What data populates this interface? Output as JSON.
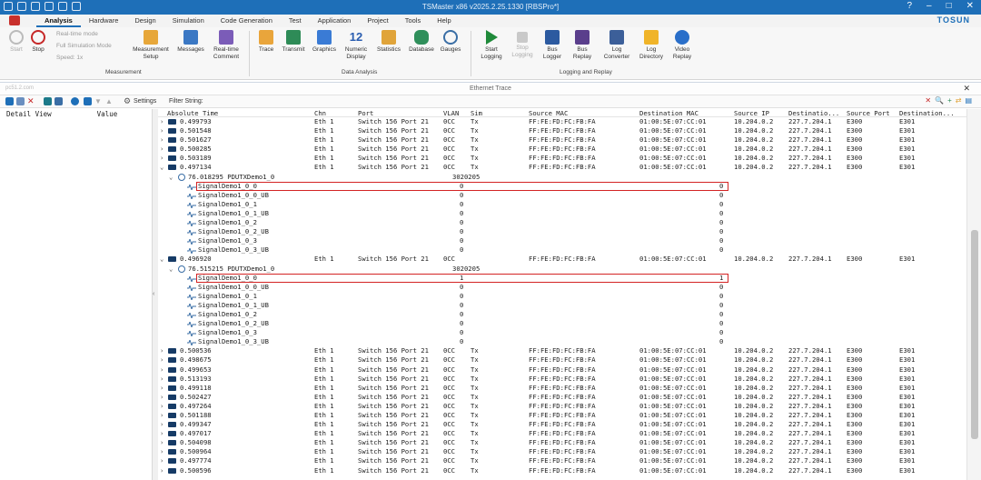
{
  "window": {
    "title": "TSMaster x86 v2025.2.25.1330 [RBSPro*]",
    "help": "?",
    "brand": "TOSUN"
  },
  "menu": [
    "Analysis",
    "Hardware",
    "Design",
    "Simulation",
    "Code Generation",
    "Test",
    "Application",
    "Project",
    "Tools",
    "Help"
  ],
  "ribbon": {
    "start": "Start",
    "stop": "Stop",
    "opt_realtime": "Real-time mode",
    "opt_fullsim": "Full Simulation Mode",
    "opt_speed": "Speed: 1x",
    "measurement_setup": "Measurement Setup",
    "messages": "Messages",
    "realtime_comment": "Real-time Comment",
    "group_measurement": "Measurement",
    "trace": "Trace",
    "transmit": "Transmit",
    "graphics": "Graphics",
    "numeric_display": "Numeric Display",
    "statistics": "Statistics",
    "database": "Database",
    "gauges": "Gauges",
    "group_data_analysis": "Data Analysis",
    "start_logging": "Start Logging",
    "stop_logging": "Stop Logging",
    "bus_logger": "Bus Logger",
    "bus_replay": "Bus Replay",
    "log_converter": "Log Converter",
    "log_directory": "Log Directory",
    "video_replay": "Video Replay",
    "group_logging": "Logging and Replay",
    "icon_colors": {
      "start": "#1f8a3a",
      "stop": "#c62828",
      "accent": "#1e6fb8"
    }
  },
  "panel": {
    "title": "Ethernet Trace",
    "path": "pc51.2.com",
    "settings": "Settings",
    "filter_label": "Filter String:"
  },
  "left": {
    "col1": "Detail View",
    "col2": "Value"
  },
  "columns": [
    "Absolute Time",
    "Chn",
    "Port",
    "VLAN",
    "Sim",
    "Source MAC",
    "Destination MAC",
    "Source IP",
    "Destinatio...",
    "Source Port",
    "Destination..."
  ],
  "rows": [
    {
      "kind": "frame",
      "time": "0.499793",
      "chn": "Eth 1",
      "port": "Switch 156 Port 21",
      "vlan": "0CC",
      "sim": "Tx",
      "smac": "FF:FE:FD:FC:FB:FA",
      "dmac": "01:00:5E:07:CC:01",
      "sip": "10.204.0.2",
      "dip": "227.7.204.1",
      "sport": "E300",
      "dport": "E301"
    },
    {
      "kind": "frame",
      "time": "0.501548",
      "chn": "Eth 1",
      "port": "Switch 156 Port 21",
      "vlan": "0CC",
      "sim": "Tx",
      "smac": "FF:FE:FD:FC:FB:FA",
      "dmac": "01:00:5E:07:CC:01",
      "sip": "10.204.0.2",
      "dip": "227.7.204.1",
      "sport": "E300",
      "dport": "E301"
    },
    {
      "kind": "frame",
      "time": "0.501627",
      "chn": "Eth 1",
      "port": "Switch 156 Port 21",
      "vlan": "0CC",
      "sim": "Tx",
      "smac": "FF:FE:FD:FC:FB:FA",
      "dmac": "01:00:5E:07:CC:01",
      "sip": "10.204.0.2",
      "dip": "227.7.204.1",
      "sport": "E300",
      "dport": "E301"
    },
    {
      "kind": "frame",
      "time": "0.500285",
      "chn": "Eth 1",
      "port": "Switch 156 Port 21",
      "vlan": "0CC",
      "sim": "Tx",
      "smac": "FF:FE:FD:FC:FB:FA",
      "dmac": "01:00:5E:07:CC:01",
      "sip": "10.204.0.2",
      "dip": "227.7.204.1",
      "sport": "E300",
      "dport": "E301"
    },
    {
      "kind": "frame",
      "time": "0.503189",
      "chn": "Eth 1",
      "port": "Switch 156 Port 21",
      "vlan": "0CC",
      "sim": "Tx",
      "smac": "FF:FE:FD:FC:FB:FA",
      "dmac": "01:00:5E:07:CC:01",
      "sip": "10.204.0.2",
      "dip": "227.7.204.1",
      "sport": "E300",
      "dport": "E301"
    },
    {
      "kind": "frame",
      "expanded": true,
      "time": "0.497134",
      "chn": "Eth 1",
      "port": "Switch 156 Port 21",
      "vlan": "0CC",
      "sim": "Tx",
      "smac": "FF:FE:FD:FC:FB:FA",
      "dmac": "01:00:5E:07:CC:01",
      "sip": "10.204.0.2",
      "dip": "227.7.204.1",
      "sport": "E300",
      "dport": "E301"
    },
    {
      "kind": "pdu",
      "name": "76.018295 PDUTXDemo1_0",
      "id": "3020205"
    },
    {
      "kind": "signal",
      "name": "SignalDemo1_0_0",
      "raw": "0",
      "phys": "0",
      "highlight": true
    },
    {
      "kind": "signal",
      "name": "SignalDemo1_0_0_UB",
      "raw": "0",
      "phys": "0"
    },
    {
      "kind": "signal",
      "name": "SignalDemo1_0_1",
      "raw": "0",
      "phys": "0"
    },
    {
      "kind": "signal",
      "name": "SignalDemo1_0_1_UB",
      "raw": "0",
      "phys": "0"
    },
    {
      "kind": "signal",
      "name": "SignalDemo1_0_2",
      "raw": "0",
      "phys": "0"
    },
    {
      "kind": "signal",
      "name": "SignalDemo1_0_2_UB",
      "raw": "0",
      "phys": "0"
    },
    {
      "kind": "signal",
      "name": "SignalDemo1_0_3",
      "raw": "0",
      "phys": "0"
    },
    {
      "kind": "signal",
      "name": "SignalDemo1_0_3_UB",
      "raw": "0",
      "phys": "0"
    },
    {
      "kind": "frame",
      "expanded": true,
      "time": "0.496920",
      "chn": "Eth 1",
      "port": "Switch 156 Port 21",
      "vlan": "0CC",
      "sim": "",
      "smac": "FF:FE:FD:FC:FB:FA",
      "dmac": "01:00:5E:07:CC:01",
      "sip": "10.204.0.2",
      "dip": "227.7.204.1",
      "sport": "E300",
      "dport": "E301"
    },
    {
      "kind": "pdu",
      "name": "76.515215 PDUTXDemo1_0",
      "id": "3020205"
    },
    {
      "kind": "signal",
      "name": "SignalDemo1_0_0",
      "raw": "1",
      "phys": "1",
      "highlight": true
    },
    {
      "kind": "signal",
      "name": "SignalDemo1_0_0_UB",
      "raw": "0",
      "phys": "0"
    },
    {
      "kind": "signal",
      "name": "SignalDemo1_0_1",
      "raw": "0",
      "phys": "0"
    },
    {
      "kind": "signal",
      "name": "SignalDemo1_0_1_UB",
      "raw": "0",
      "phys": "0"
    },
    {
      "kind": "signal",
      "name": "SignalDemo1_0_2",
      "raw": "0",
      "phys": "0"
    },
    {
      "kind": "signal",
      "name": "SignalDemo1_0_2_UB",
      "raw": "0",
      "phys": "0"
    },
    {
      "kind": "signal",
      "name": "SignalDemo1_0_3",
      "raw": "0",
      "phys": "0"
    },
    {
      "kind": "signal",
      "name": "SignalDemo1_0_3_UB",
      "raw": "0",
      "phys": "0"
    },
    {
      "kind": "frame",
      "time": "0.500536",
      "chn": "Eth 1",
      "port": "Switch 156 Port 21",
      "vlan": "0CC",
      "sim": "Tx",
      "smac": "FF:FE:FD:FC:FB:FA",
      "dmac": "01:00:5E:07:CC:01",
      "sip": "10.204.0.2",
      "dip": "227.7.204.1",
      "sport": "E300",
      "dport": "E301"
    },
    {
      "kind": "frame",
      "time": "0.498675",
      "chn": "Eth 1",
      "port": "Switch 156 Port 21",
      "vlan": "0CC",
      "sim": "Tx",
      "smac": "FF:FE:FD:FC:FB:FA",
      "dmac": "01:00:5E:07:CC:01",
      "sip": "10.204.0.2",
      "dip": "227.7.204.1",
      "sport": "E300",
      "dport": "E301"
    },
    {
      "kind": "frame",
      "time": "0.499653",
      "chn": "Eth 1",
      "port": "Switch 156 Port 21",
      "vlan": "0CC",
      "sim": "Tx",
      "smac": "FF:FE:FD:FC:FB:FA",
      "dmac": "01:00:5E:07:CC:01",
      "sip": "10.204.0.2",
      "dip": "227.7.204.1",
      "sport": "E300",
      "dport": "E301"
    },
    {
      "kind": "frame",
      "time": "0.513193",
      "chn": "Eth 1",
      "port": "Switch 156 Port 21",
      "vlan": "0CC",
      "sim": "Tx",
      "smac": "FF:FE:FD:FC:FB:FA",
      "dmac": "01:00:5E:07:CC:01",
      "sip": "10.204.0.2",
      "dip": "227.7.204.1",
      "sport": "E300",
      "dport": "E301"
    },
    {
      "kind": "frame",
      "time": "0.499118",
      "chn": "Eth 1",
      "port": "Switch 156 Port 21",
      "vlan": "0CC",
      "sim": "Tx",
      "smac": "FF:FE:FD:FC:FB:FA",
      "dmac": "01:00:5E:07:CC:01",
      "sip": "10.204.0.2",
      "dip": "227.7.204.1",
      "sport": "E300",
      "dport": "E301"
    },
    {
      "kind": "frame",
      "time": "0.502427",
      "chn": "Eth 1",
      "port": "Switch 156 Port 21",
      "vlan": "0CC",
      "sim": "Tx",
      "smac": "FF:FE:FD:FC:FB:FA",
      "dmac": "01:00:5E:07:CC:01",
      "sip": "10.204.0.2",
      "dip": "227.7.204.1",
      "sport": "E300",
      "dport": "E301"
    },
    {
      "kind": "frame",
      "time": "0.497264",
      "chn": "Eth 1",
      "port": "Switch 156 Port 21",
      "vlan": "0CC",
      "sim": "Tx",
      "smac": "FF:FE:FD:FC:FB:FA",
      "dmac": "01:00:5E:07:CC:01",
      "sip": "10.204.0.2",
      "dip": "227.7.204.1",
      "sport": "E300",
      "dport": "E301"
    },
    {
      "kind": "frame",
      "time": "0.501188",
      "chn": "Eth 1",
      "port": "Switch 156 Port 21",
      "vlan": "0CC",
      "sim": "Tx",
      "smac": "FF:FE:FD:FC:FB:FA",
      "dmac": "01:00:5E:07:CC:01",
      "sip": "10.204.0.2",
      "dip": "227.7.204.1",
      "sport": "E300",
      "dport": "E301"
    },
    {
      "kind": "frame",
      "time": "0.499347",
      "chn": "Eth 1",
      "port": "Switch 156 Port 21",
      "vlan": "0CC",
      "sim": "Tx",
      "smac": "FF:FE:FD:FC:FB:FA",
      "dmac": "01:00:5E:07:CC:01",
      "sip": "10.204.0.2",
      "dip": "227.7.204.1",
      "sport": "E300",
      "dport": "E301"
    },
    {
      "kind": "frame",
      "time": "0.497017",
      "chn": "Eth 1",
      "port": "Switch 156 Port 21",
      "vlan": "0CC",
      "sim": "Tx",
      "smac": "FF:FE:FD:FC:FB:FA",
      "dmac": "01:00:5E:07:CC:01",
      "sip": "10.204.0.2",
      "dip": "227.7.204.1",
      "sport": "E300",
      "dport": "E301"
    },
    {
      "kind": "frame",
      "time": "0.504098",
      "chn": "Eth 1",
      "port": "Switch 156 Port 21",
      "vlan": "0CC",
      "sim": "Tx",
      "smac": "FF:FE:FD:FC:FB:FA",
      "dmac": "01:00:5E:07:CC:01",
      "sip": "10.204.0.2",
      "dip": "227.7.204.1",
      "sport": "E300",
      "dport": "E301"
    },
    {
      "kind": "frame",
      "time": "0.500964",
      "chn": "Eth 1",
      "port": "Switch 156 Port 21",
      "vlan": "0CC",
      "sim": "Tx",
      "smac": "FF:FE:FD:FC:FB:FA",
      "dmac": "01:00:5E:07:CC:01",
      "sip": "10.204.0.2",
      "dip": "227.7.204.1",
      "sport": "E300",
      "dport": "E301"
    },
    {
      "kind": "frame",
      "time": "0.497774",
      "chn": "Eth 1",
      "port": "Switch 156 Port 21",
      "vlan": "0CC",
      "sim": "Tx",
      "smac": "FF:FE:FD:FC:FB:FA",
      "dmac": "01:00:5E:07:CC:01",
      "sip": "10.204.0.2",
      "dip": "227.7.204.1",
      "sport": "E300",
      "dport": "E301"
    },
    {
      "kind": "frame",
      "time": "0.500596",
      "chn": "Eth 1",
      "port": "Switch 156 Port 21",
      "vlan": "0CC",
      "sim": "Tx",
      "smac": "FF:FE:FD:FC:FB:FA",
      "dmac": "01:00:5E:07:CC:01",
      "sip": "10.204.0.2",
      "dip": "227.7.204.1",
      "sport": "E300",
      "dport": "E301"
    }
  ]
}
